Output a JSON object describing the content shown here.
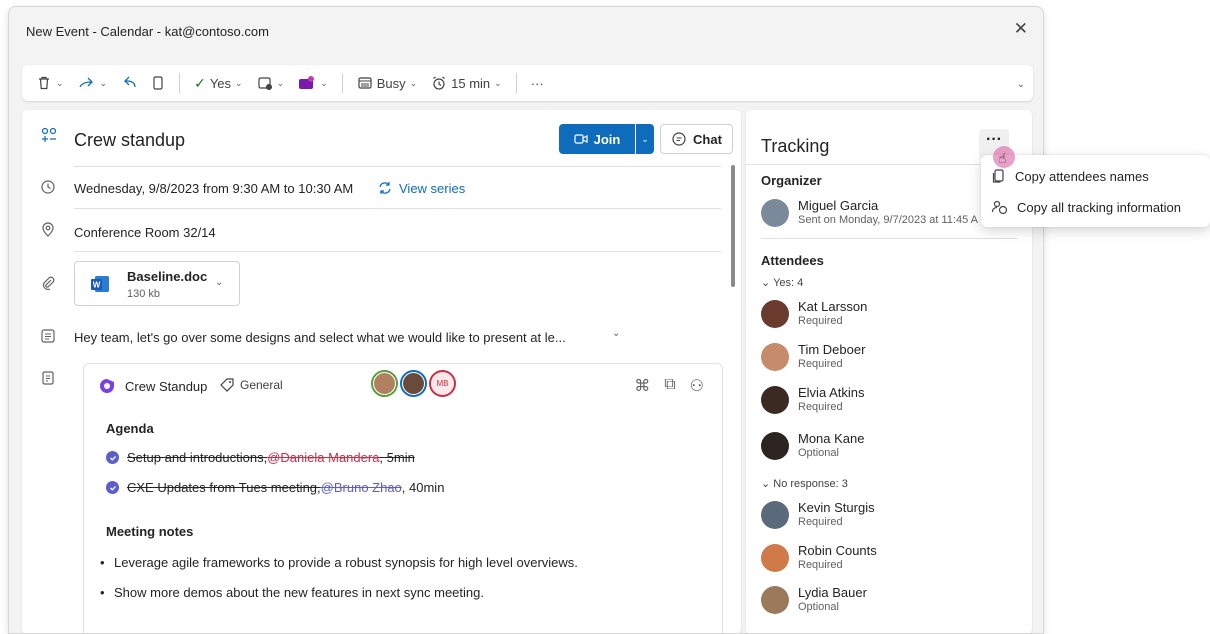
{
  "window": {
    "title": "New Event - Calendar - kat@contoso.com"
  },
  "toolbar": {
    "yes_label": "Yes",
    "busy_label": "Busy",
    "reminder_label": "15 min",
    "more_label": "···"
  },
  "event": {
    "title": "Crew standup",
    "join_label": "Join",
    "chat_label": "Chat",
    "datetime": "Wednesday, 9/8/2023 from 9:30 AM to 10:30 AM",
    "view_series_label": "View series",
    "location": "Conference Room 32/14",
    "attachment": {
      "name": "Baseline.doc",
      "size": "130 kb"
    },
    "body_preview": "Hey team, let's go over some designs and select what we would like to present at le..."
  },
  "loop": {
    "name": "Crew Standup",
    "tag": "General",
    "avatar_mb": "MB",
    "agenda_heading": "Agenda",
    "tasks": [
      {
        "text": "Setup and introductions, ",
        "mention": "@Daniela Mandera",
        "tail": ", 5min"
      },
      {
        "text": "CXE Updates from Tues meeting, ",
        "mention": "@Bruno Zhao",
        "tail": ", 40min"
      }
    ],
    "notes_heading": "Meeting notes",
    "notes": [
      "Leverage agile frameworks to provide a robust synopsis for high level overviews.",
      "Show more demos about the new features in next sync meeting."
    ]
  },
  "tracking": {
    "title": "Tracking",
    "more_label": "···",
    "organizer_heading": "Organizer",
    "organizer": {
      "name": "Miguel Garcia",
      "sent": "Sent on Monday, 9/7/2023 at 11:45 A"
    },
    "attendees_heading": "Attendees",
    "yes_group": "Yes: 4",
    "no_response_group": "No response: 3",
    "attendees": [
      {
        "name": "Kat Larsson",
        "role": "Required",
        "color": "#6b3a2e"
      },
      {
        "name": "Tim Deboer",
        "role": "Required",
        "color": "#c58b6a"
      },
      {
        "name": "Elvia Atkins",
        "role": "Required",
        "color": "#3b2a22"
      },
      {
        "name": "Mona Kane",
        "role": "Optional",
        "color": "#2c2420"
      },
      {
        "name": "Kevin Sturgis",
        "role": "Required",
        "color": "#5a6a7a"
      },
      {
        "name": "Robin Counts",
        "role": "Required",
        "color": "#d07a4a"
      },
      {
        "name": "Lydia Bauer",
        "role": "Optional",
        "color": "#9a7a5a"
      }
    ]
  },
  "menu": {
    "items": [
      {
        "label": "Copy attendees names"
      },
      {
        "label": "Copy all tracking information"
      }
    ]
  },
  "colors": {
    "accent": "#0f6cbd",
    "loop_purple": "#5b5fc7",
    "mention_red": "#c4314b"
  }
}
